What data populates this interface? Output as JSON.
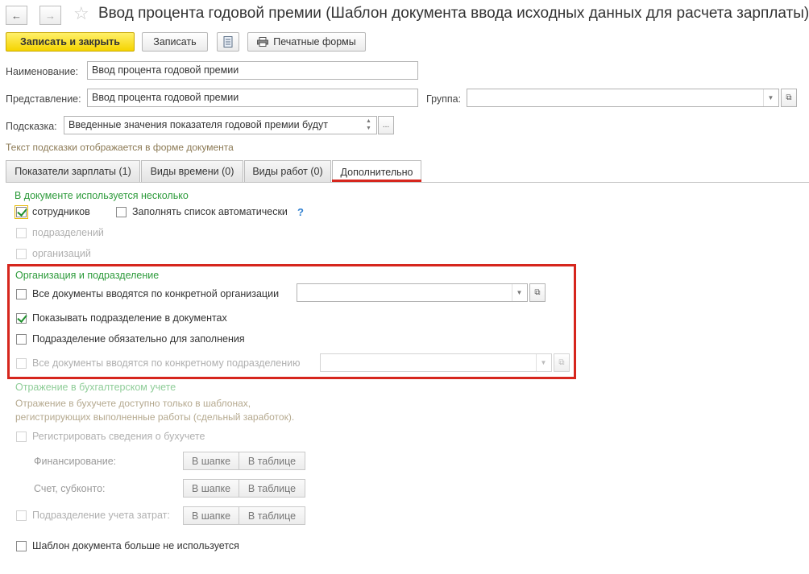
{
  "header": {
    "back_icon": "arrow-left-icon",
    "forward_icon": "arrow-right-icon",
    "favorite_icon": "star-icon",
    "title": "Ввод процента годовой премии (Шаблон документа ввода исходных данных для расчета зарплаты)"
  },
  "toolbar": {
    "save_close": "Записать и закрыть",
    "save": "Записать",
    "report_icon": "document-list-icon",
    "print_forms": "Печатные формы",
    "print_icon": "printer-icon"
  },
  "fields": {
    "name_label": "Наименование:",
    "name_value": "Ввод процента годовой премии",
    "presentation_label": "Представление:",
    "presentation_value": "Ввод процента годовой премии",
    "group_label": "Группа:",
    "group_value": "",
    "hint_label": "Подсказка:",
    "hint_value": "Введенные значения показателя годовой премии будут",
    "hint_note": "Текст подсказки отображается в форме документа",
    "more_btn": "...",
    "open_icon": "open-window-icon",
    "dropdown_icon": "chevron-down-icon"
  },
  "tabs": [
    {
      "label": "Показатели зарплаты (1)"
    },
    {
      "label": "Виды времени (0)"
    },
    {
      "label": "Виды работ (0)"
    },
    {
      "label": "Дополнительно"
    }
  ],
  "multi": {
    "title": "В документе используется несколько",
    "employees": "сотрудников",
    "employees_checked": true,
    "autofill": "Заполнять список автоматически",
    "autofill_checked": false,
    "help": "?",
    "departments": "подразделений",
    "organizations": "организаций"
  },
  "org": {
    "title": "Организация и подразделение",
    "all_docs_org": "Все документы вводятся по конкретной организации",
    "all_docs_org_checked": false,
    "show_dept": "Показывать подразделение в документах",
    "show_dept_checked": true,
    "dept_required": "Подразделение обязательно для заполнения",
    "dept_required_checked": false,
    "all_docs_dept": "Все документы вводятся по конкретному подразделению",
    "all_docs_dept_checked": false
  },
  "accounting": {
    "title": "Отражение в бухгалтерском учете",
    "note_line1": "Отражение в бухучете доступно только в шаблонах,",
    "note_line2": "регистрирующих выполненные работы (сдельный заработок).",
    "register": "Регистрировать сведения о бухучете",
    "financing_label": "Финансирование:",
    "account_label": "Счет, субконто:",
    "cost_dept_label": "Подразделение учета затрат:",
    "in_header": "В шапке",
    "in_table": "В таблице"
  },
  "footer": {
    "unused": "Шаблон документа больше не используется",
    "unused_checked": false
  },
  "colors": {
    "accent_yellow": "#f5d400",
    "section_green": "#2d9b3b",
    "highlight_red": "#d6261d"
  }
}
